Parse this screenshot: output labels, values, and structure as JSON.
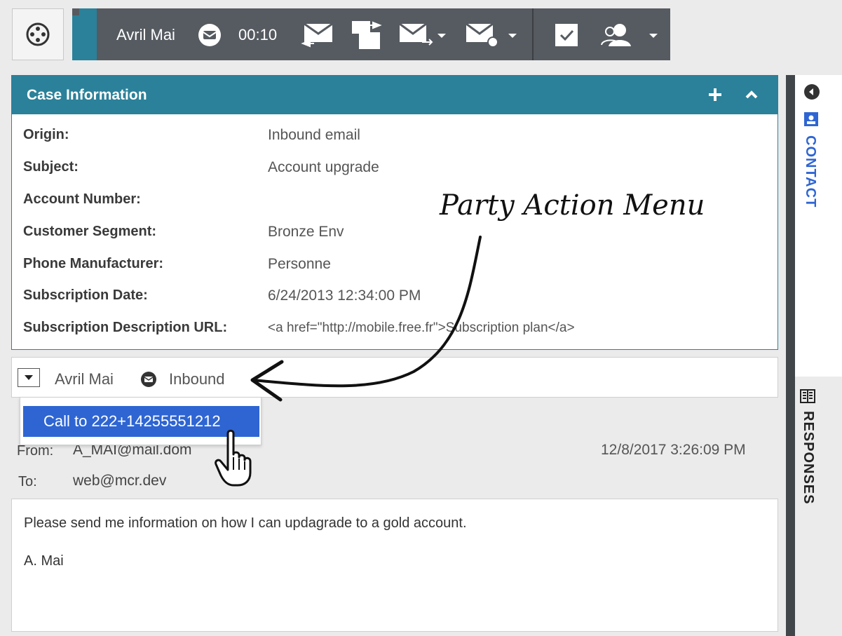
{
  "toolbar": {
    "contact_name": "Avril Mai",
    "timer": "00:10",
    "icons": [
      "menu-icon",
      "email-icon",
      "reply-email-icon",
      "forward-email-icon",
      "transfer-email-icon",
      "email-actions-icon",
      "done-checkbox-icon",
      "consult-user-icon"
    ]
  },
  "case": {
    "title": "Case Information",
    "rows": [
      {
        "label": "Origin:",
        "value": "Inbound email"
      },
      {
        "label": "Subject:",
        "value": "Account upgrade"
      },
      {
        "label": "Account Number:",
        "value": ""
      },
      {
        "label": "Customer Segment:",
        "value": "Bronze Env"
      },
      {
        "label": "Phone Manufacturer:",
        "value": "Personne"
      },
      {
        "label": "Subscription Date:",
        "value": "6/24/2013 12:34:00 PM"
      },
      {
        "label": "Subscription Description URL:",
        "value": "<a href=\"http://mobile.free.fr\">Subscription plan</a>"
      }
    ]
  },
  "party": {
    "name": "Avril Mai",
    "status": "Inbound",
    "menu_item": "Call to 222+14255551212"
  },
  "email": {
    "from_label": "From:",
    "from_value": "A_MAI@mail.dom",
    "to_label": "To:",
    "to_value": "web@mcr.dev",
    "date": "12/8/2017 3:26:09 PM",
    "body_lines": [
      "Please send me information on how I can updagrade to a gold account.",
      "A. Mai"
    ]
  },
  "side_tabs": {
    "contact": "CONTACT",
    "responses": "RESPONSES"
  },
  "annotation": "Party Action Menu",
  "colors": {
    "header_teal": "#2b8199",
    "toolbar_gray": "#565b61",
    "menu_blue": "#2e65d3"
  }
}
